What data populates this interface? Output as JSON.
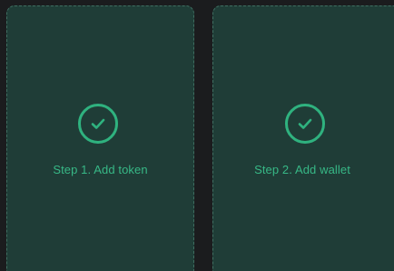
{
  "steps": [
    {
      "label": "Step 1. Add token",
      "status": "complete",
      "icon": "checkmark-circle-icon"
    },
    {
      "label": "Step 2. Add wallet",
      "status": "complete",
      "icon": "checkmark-circle-icon"
    }
  ],
  "colors": {
    "background": "#1b1c1e",
    "card": "#1f3d37",
    "card_border": "#3f6f61",
    "accent": "#2fb27f"
  }
}
